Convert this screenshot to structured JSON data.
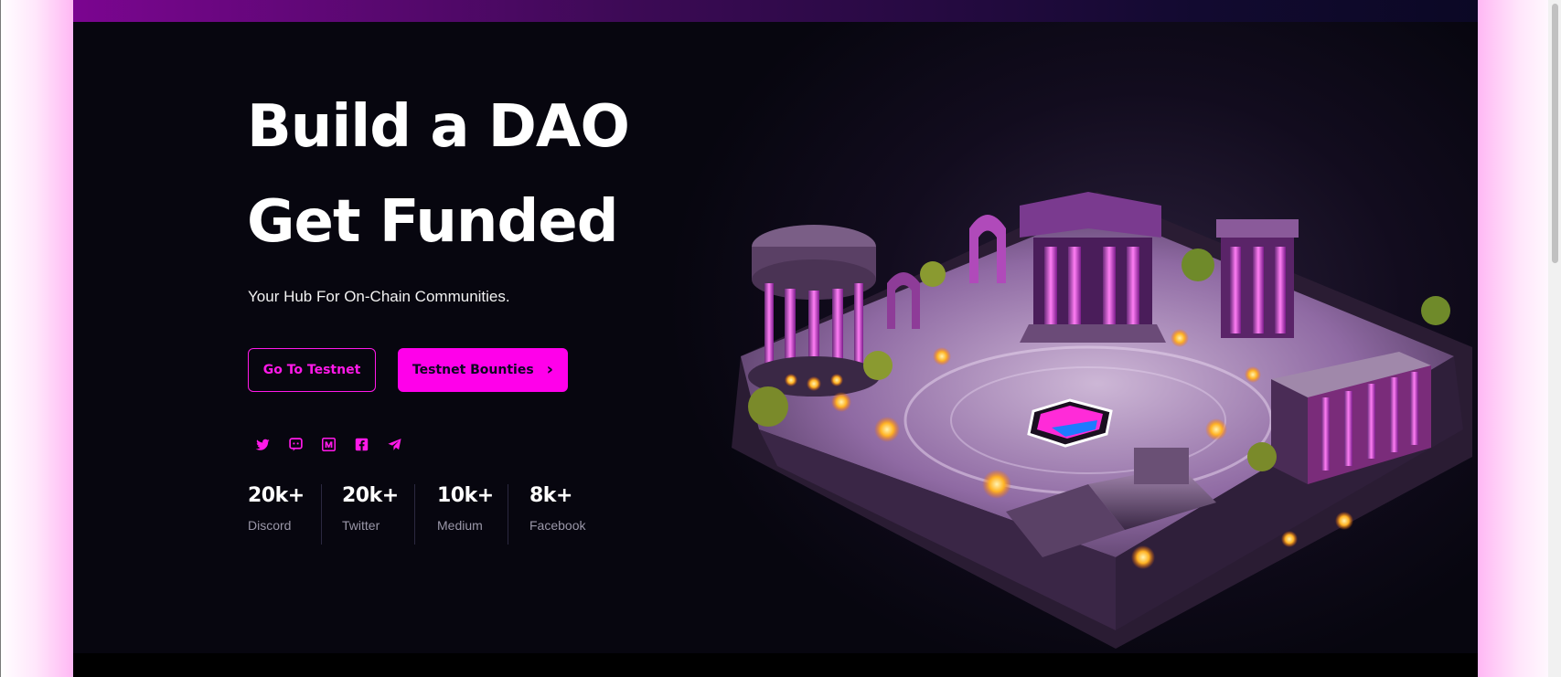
{
  "hero": {
    "headline_line1": "Build a DAO",
    "headline_line2": "Get Funded",
    "subtitle": "Your Hub For On-Chain Communities."
  },
  "buttons": {
    "testnet_label": "Go To Testnet",
    "bounties_label": "Testnet Bounties",
    "bounties_chevron": "›"
  },
  "socials": [
    {
      "icon": "twitter-icon"
    },
    {
      "icon": "discord-icon"
    },
    {
      "icon": "medium-icon"
    },
    {
      "icon": "facebook-icon"
    },
    {
      "icon": "telegram-icon"
    }
  ],
  "stats": [
    {
      "value": "20k+",
      "label": "Discord"
    },
    {
      "value": "20k+",
      "label": "Twitter"
    },
    {
      "value": "10k+",
      "label": "Medium"
    },
    {
      "value": "8k+",
      "label": "Facebook"
    }
  ],
  "colors": {
    "accent": "#ff00ea",
    "background": "#07060f",
    "text": "#ffffff",
    "muted": "#9a97a8"
  }
}
